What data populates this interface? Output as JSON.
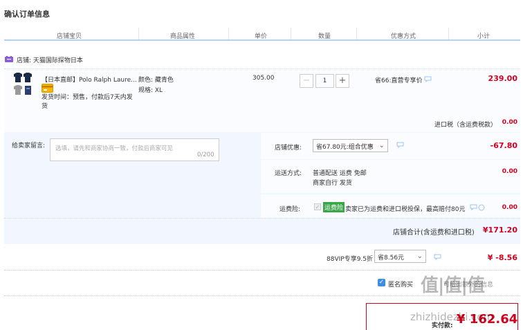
{
  "page_title": "确认订单信息",
  "columns": [
    "店铺宝贝",
    "商品属性",
    "单价",
    "数量",
    "优惠方式",
    "小计"
  ],
  "store": {
    "label": "店铺: 天猫国际探物日本"
  },
  "item": {
    "name": "【日本直邮】Polo Ralph Laure...",
    "ship_time": "发货时间：预售，付款后7天内发货",
    "color_label": "颜色: 藏青色",
    "size_label": "规格: XL",
    "unit_price": "305.00",
    "quantity": "1",
    "minus": "−",
    "plus": "+",
    "discount": "省66:直营专享价",
    "subtotal": "239.00"
  },
  "import_tax": {
    "label": "进口税（含运费税款）",
    "value": "0.00"
  },
  "message": {
    "label": "给卖家留言:",
    "placeholder": "选填，请先和商家协商一致，付款后商家可见",
    "count": "0/200"
  },
  "store_discount": {
    "label": "店铺优惠:",
    "selected": "省67.80元:组合优惠",
    "value": "-67.80"
  },
  "shipping": {
    "label": "运送方式:",
    "line1": "普通配送 运费 免邮",
    "line2": "商家自行 发货",
    "value": "0.00"
  },
  "shipping_insurance": {
    "label": "运费险:",
    "badge": "运费险",
    "desc": "卖家已为运费和进口税投保，最高赔付80元",
    "value": "0.00"
  },
  "store_total": {
    "label": "店铺合计(含运费和进口税)",
    "value": "¥171.20"
  },
  "vip": {
    "label": "88VIP专享9.5折",
    "selected": "省8.56元",
    "value": "¥ -8.56"
  },
  "anonymous": {
    "label": "匿名购买",
    "extra": "可给出额外的信息"
  },
  "pay": {
    "label": "实付款:",
    "value": "¥ 162.64"
  },
  "watermark": {
    "text": "值|值|值",
    "url": "zhizhidezhi.com"
  },
  "colors": {
    "accent_red": "#d4001d",
    "header_line": "#b2d1ff",
    "panel_bg": "#f2f7ff",
    "checkbox": "#3d8de7"
  }
}
